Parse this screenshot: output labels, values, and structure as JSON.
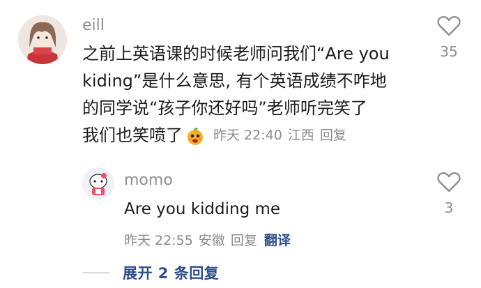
{
  "comment": {
    "username": "eill",
    "lines": [
      "之前上英语课的时候老师问我们“Are you",
      "kiding”是什么意思, 有个英语成绩不咋地",
      "的同学说“孩子你还好吗”老师听完笑了",
      "我们也笑喷了"
    ],
    "emoji": "orange-face-emoji",
    "time": "昨天 22:40",
    "location": "江西",
    "reply_label": "回复",
    "likes": "35"
  },
  "reply": {
    "username": "momo",
    "text": "Are you kidding me",
    "time": "昨天 22:55",
    "location": "安徽",
    "reply_label": "回复",
    "translate_label": "翻译",
    "likes": "3"
  },
  "expand": {
    "label": "展开 2 条回复"
  },
  "colors": {
    "accent": "#2d4f8a",
    "meta": "#8b8b8b"
  }
}
